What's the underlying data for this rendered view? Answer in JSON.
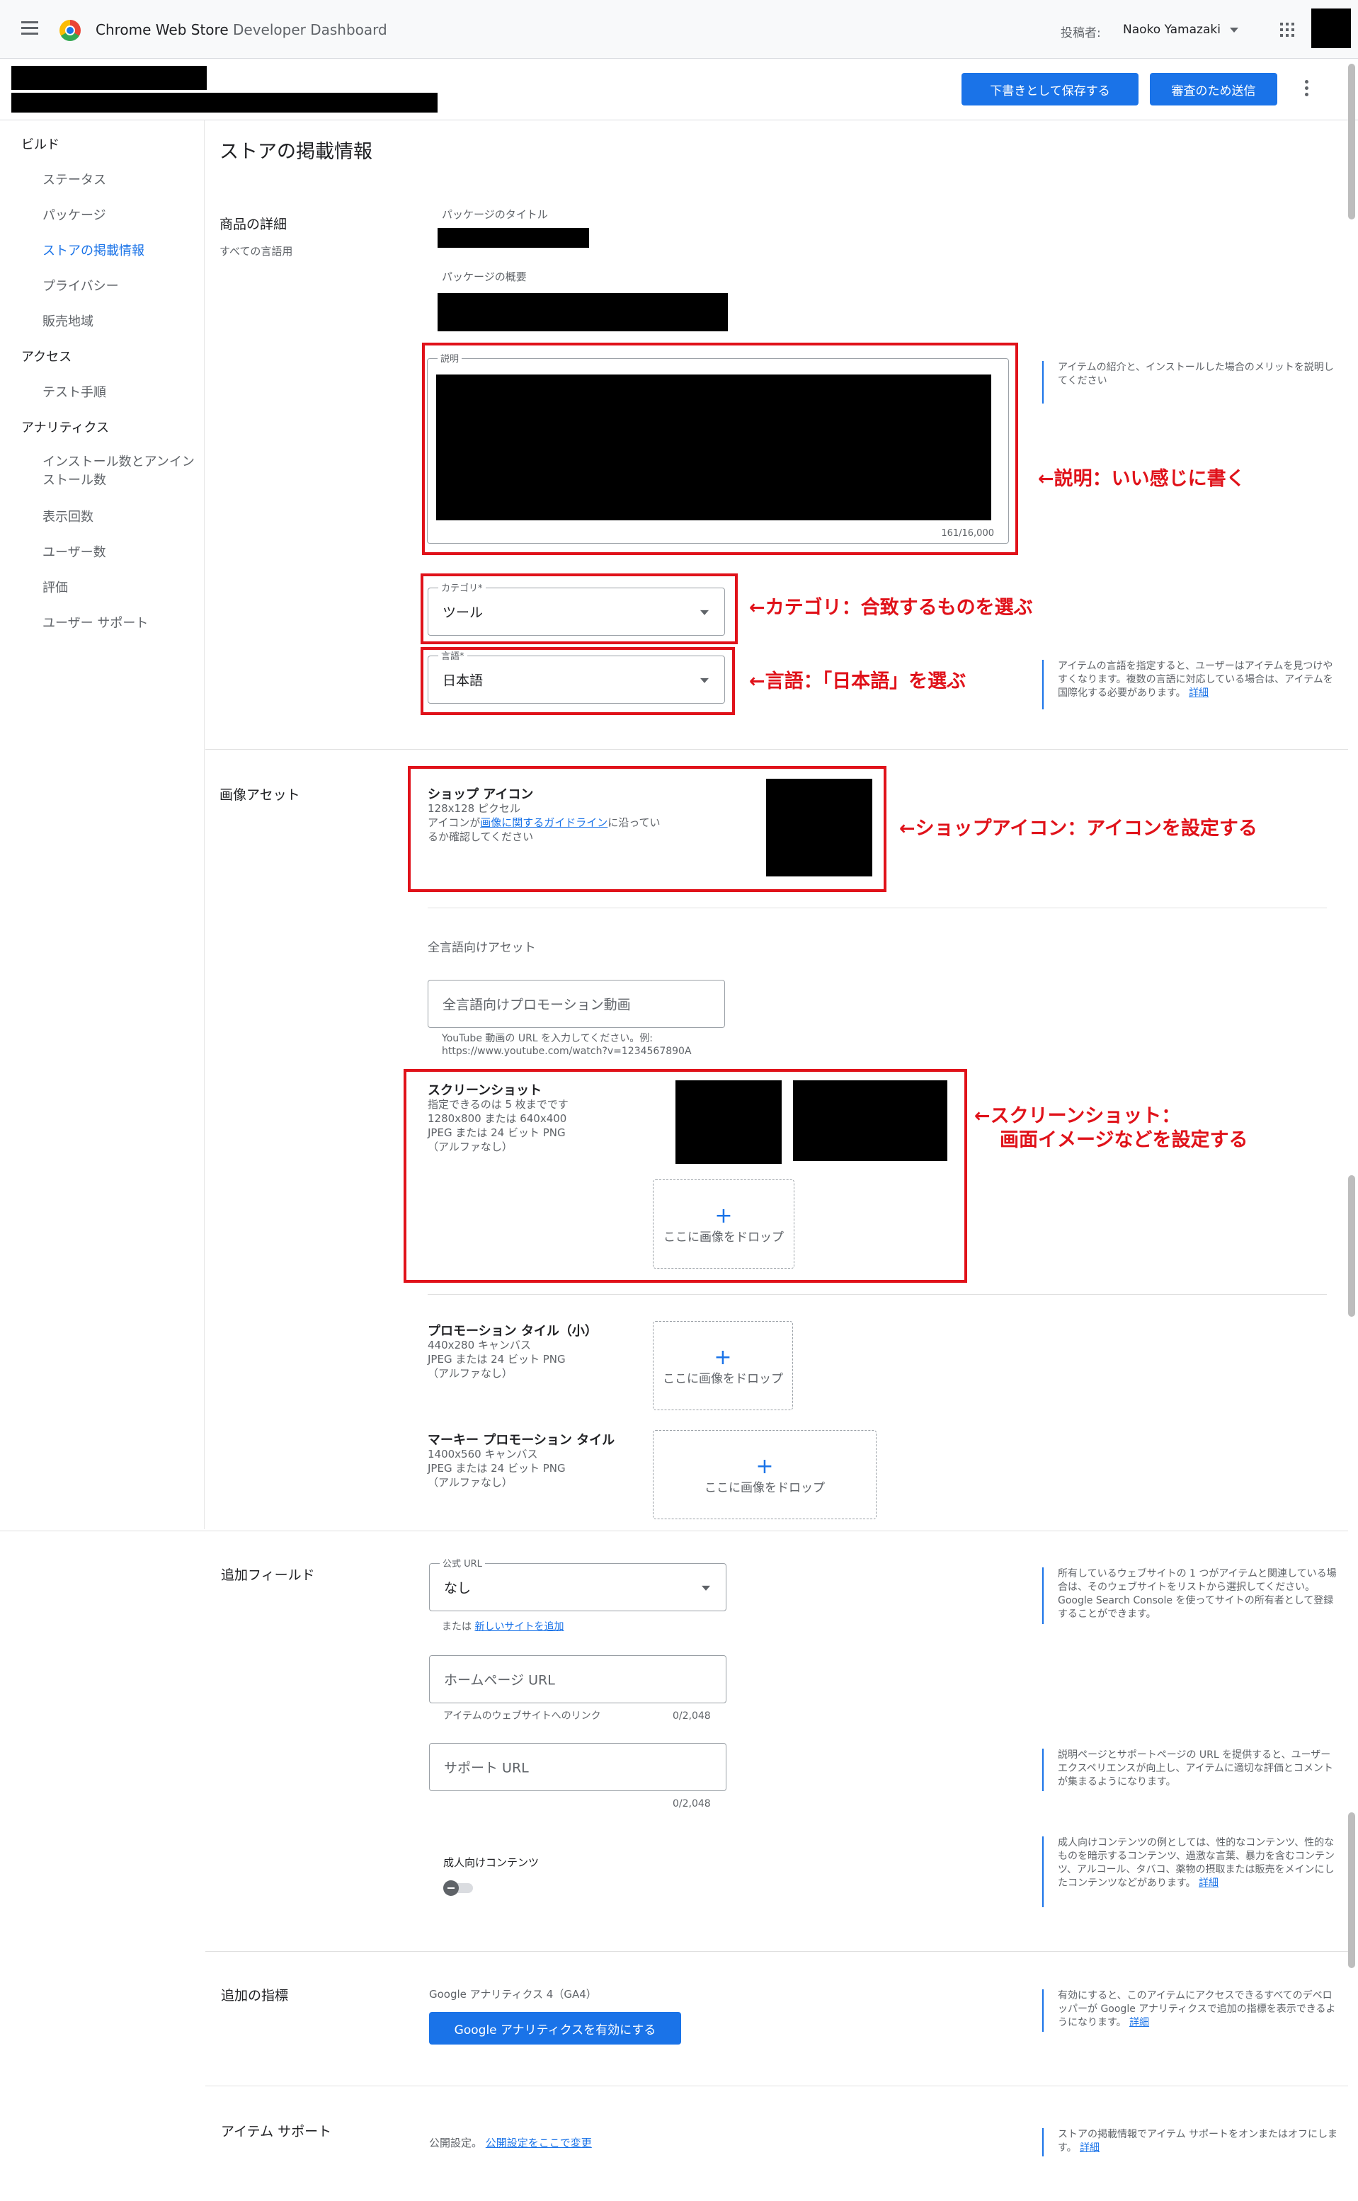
{
  "topbar": {
    "app_title": "Chrome Web Store",
    "app_subtitle": " Developer Dashboard",
    "publisher_label": "投稿者:",
    "publisher_name": "Naoko Yamazaki"
  },
  "subbar": {
    "save_draft": "下書きとして保存する",
    "submit": "審査のため送信"
  },
  "sidebar": {
    "sections": [
      {
        "label": "ビルド",
        "items": [
          "ステータス",
          "パッケージ",
          "ストアの掲載情報",
          "プライバシー",
          "販売地域"
        ]
      },
      {
        "label": "アクセス",
        "items": [
          "テスト手順"
        ]
      },
      {
        "label": "アナリティクス",
        "items": [
          "インストール数とアンイン\nストール数",
          "表示回数",
          "ユーザー数",
          "評価",
          "ユーザー サポート"
        ]
      }
    ],
    "active_item": "ストアの掲載情報"
  },
  "page": {
    "title": "ストアの掲載情報"
  },
  "details": {
    "section_title": "商品の詳細",
    "section_sub": "すべての言語用",
    "package_title_label": "パッケージのタイトル",
    "package_summary_label": "パッケージの概要",
    "description_label": "説明",
    "description_count": "161/16,000",
    "description_help": "アイテムの紹介と、インストールした場合のメリットを説明してください",
    "category_label": "カテゴリ*",
    "category_value": "ツール",
    "language_label": "言語*",
    "language_value": "日本語",
    "language_help": "アイテムの言語を指定すると、ユーザーはアイテムを見つけやすくなります。複数の言語に対応している場合は、アイテムを国際化する必要があります。",
    "language_help_link": "詳細"
  },
  "assets": {
    "section_title": "画像アセット",
    "icon_title": "ショップ アイコン",
    "icon_size": "128x128 ピクセル",
    "icon_desc_pre": "アイコンが",
    "icon_desc_link": "画像に関するガイドライン",
    "icon_desc_post": "に沿ってい",
    "icon_desc_line2": "るか確認してください",
    "global_assets_label": "全言語向けアセット",
    "promo_video_placeholder": "全言語向けプロモーション動画",
    "promo_video_hint1": "YouTube 動画の URL を入力してください。例:",
    "promo_video_hint2": "https://www.youtube.com/watch?v=1234567890A",
    "screenshot_title": "スクリーンショット",
    "screenshot_desc1": "指定できるのは 5 枚までです",
    "screenshot_desc2": "1280x800 または 640x400",
    "screenshot_desc3": "JPEG または 24 ビット PNG",
    "screenshot_desc4": "（アルファなし）",
    "drop_label": "ここに画像をドロップ",
    "small_tile_title": "プロモーション タイル（小）",
    "small_tile_desc1": "440x280 キャンバス",
    "small_tile_desc2": "JPEG または 24 ビット PNG",
    "small_tile_desc3": "（アルファなし）",
    "marquee_title": "マーキー プロモーション タイル",
    "marquee_desc1": "1400x560 キャンバス",
    "marquee_desc2": "JPEG または 24 ビット PNG",
    "marquee_desc3": "（アルファなし）",
    "plus": "+"
  },
  "annotations": {
    "desc": "←説明：いい感じに書く",
    "category": "←カテゴリ：合致するものを選ぶ",
    "language": "←言語：「日本語」を選ぶ",
    "icon": "←ショップアイコン：アイコンを設定する",
    "screenshot1": "←スクリーンショット：",
    "screenshot2": "画面イメージなどを設定する"
  },
  "additional": {
    "section_title": "追加フィールド",
    "official_url_label": "公式 URL",
    "official_url_value": "なし",
    "add_site_pre": "または",
    "add_site_link": "新しいサイトを追加",
    "official_url_help": "所有しているウェブサイトの 1 つがアイテムと関連している場合は、そのウェブサイトをリストから選択してください。Google Search Console を使ってサイトの所有者として登録することができます。",
    "homepage_placeholder": "ホームページ URL",
    "homepage_hint": "アイテムのウェブサイトへのリンク",
    "homepage_count": "0/2,048",
    "support_placeholder": "サポート URL",
    "support_count": "0/2,048",
    "support_help": "説明ページとサポートページの URL を提供すると、ユーザー エクスペリエンスが向上し、アイテムに適切な評価とコメントが集まるようになります。",
    "mature_label": "成人向けコンテンツ",
    "mature_help": "成人向けコンテンツの例としては、性的なコンテンツ、性的なものを暗示するコンテンツ、過激な言葉、暴力を含むコンテンツ、アルコール、タバコ、薬物の摂取または販売をメインにしたコンテンツなどがあります。",
    "mature_help_link": "詳細"
  },
  "metrics": {
    "section_title": "追加の指標",
    "ga_label": "Google アナリティクス 4（GA4）",
    "ga_button": "Google アナリティクスを有効にする",
    "help": "有効にすると、このアイテムにアクセスできるすべてのデベロッパーが Google アナリティクスで追加の指標を表示できるようになります。",
    "help_link": "詳細"
  },
  "support": {
    "section_title": "アイテム サポート",
    "visibility_pre": "公開設定。",
    "visibility_link": "公開設定をここで変更",
    "help": "ストアの掲載情報でアイテム サポートをオンまたはオフにします。",
    "help_link": "詳細"
  },
  "colors": {
    "accent": "#1a73e8",
    "annotation_red": "#e0121a"
  }
}
